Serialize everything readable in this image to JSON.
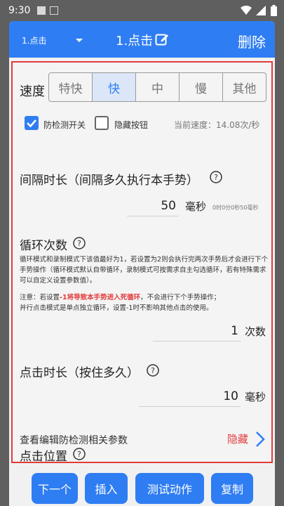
{
  "status_bar": {
    "time": "9:30"
  },
  "header": {
    "selector_value": "1.点击",
    "title": "1.点击",
    "delete_label": "删除"
  },
  "speed": {
    "label": "速度",
    "options": [
      "特快",
      "快",
      "中",
      "慢",
      "其他"
    ],
    "selected": "快"
  },
  "checkboxes": {
    "anti_detect": {
      "label": "防检测开关",
      "checked": true
    },
    "hide_button": {
      "label": "隐藏按钮",
      "checked": false
    }
  },
  "current_speed": "当前速度：14.08次/秒",
  "interval": {
    "title": "间隔时长（间隔多久执行本手势）",
    "value": "50",
    "unit": "毫秒",
    "hint": "0时0分0秒50毫秒"
  },
  "loop": {
    "title": "循环次数",
    "description": "循环模式和录制模式下该值最好为1，若设置为2则会执行完两次手势后才会进行下个手势操作（循环模式默认自带循环，录制模式可按需求自主勾选循环，若有特殊需求可以自定义设置参数值）。",
    "note_prefix": "注意：若设置",
    "note_red": "-1将导致本手势进入死循环",
    "note_suffix": "，不会进行下个手势操作；",
    "note_line2": "并行点击模式是单点独立循环，设置-1时不影响其他点击的使用。",
    "value": "1",
    "unit": "次数"
  },
  "press": {
    "title": "点击时长（按住多久）",
    "value": "10",
    "unit": "毫秒"
  },
  "anti_detect_params": {
    "label": "查看编辑防检测相关参数",
    "toggle_label": "隐藏"
  },
  "click_position": {
    "title": "点击位置"
  },
  "footer": {
    "next": "下一个",
    "insert": "插入",
    "test": "测试动作",
    "copy": "复制"
  },
  "colors": {
    "primary": "#2f7df2",
    "highlight_border": "#e23b3b",
    "selected_segment_bg": "#dbe7f8"
  }
}
